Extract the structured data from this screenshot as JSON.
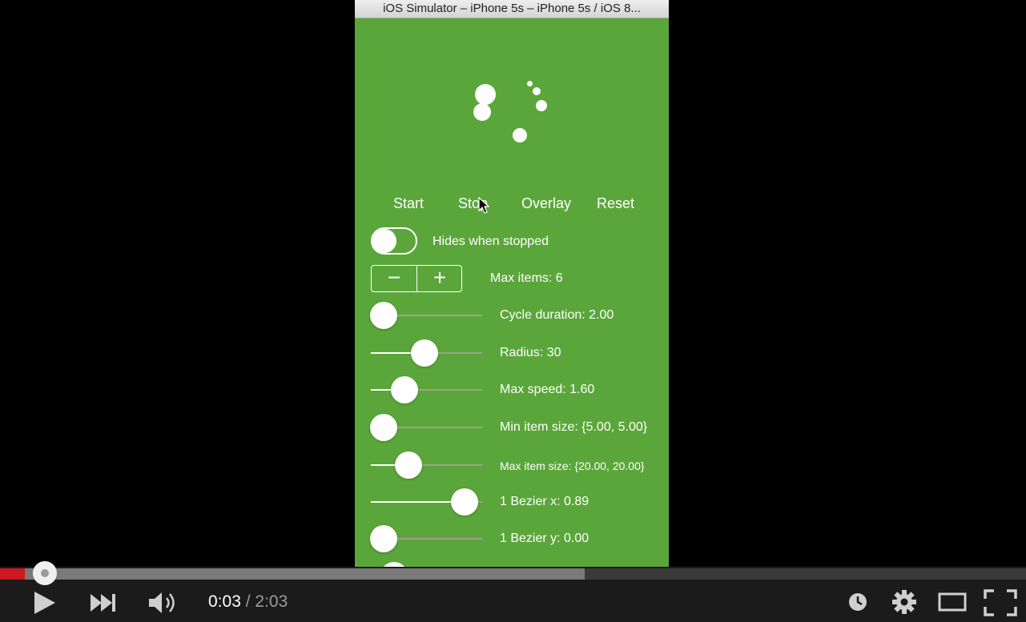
{
  "simulator": {
    "window_title": "iOS Simulator – iPhone 5s – iPhone 5s / iOS 8...",
    "background_color": "#5ba63b"
  },
  "controls": {
    "start_label": "Start",
    "stop_label": "Stop",
    "overlay_label": "Overlay",
    "reset_label": "Reset",
    "hides_toggle_label": "Hides when stopped",
    "hides_toggle_on": false,
    "stepper_minus": "−",
    "stepper_plus": "+",
    "max_items_label": "Max items: 6"
  },
  "sliders": [
    {
      "label": "Cycle duration: 2.00",
      "position": 0.0
    },
    {
      "label": "Radius: 30",
      "position": 0.45
    },
    {
      "label": "Max speed: 1.60",
      "position": 0.23
    },
    {
      "label": "Min item size: {5.00, 5.00}",
      "position": 0.0
    },
    {
      "label": "Max item size: {20.00, 20.00}",
      "position": 0.27
    },
    {
      "label": "1 Bezier x: 0.89",
      "position": 0.89
    },
    {
      "label": "1 Bezier y: 0.00",
      "position": 0.0
    }
  ],
  "player": {
    "current_time": "0:03",
    "separator": " / ",
    "duration": "2:03",
    "played_fraction": 0.024,
    "buffered_fraction": 0.57,
    "accent_color": "#cc181e",
    "icons": [
      "play-icon",
      "next-icon",
      "volume-icon",
      "watch-later-icon",
      "settings-icon",
      "theater-mode-icon",
      "fullscreen-icon"
    ]
  }
}
